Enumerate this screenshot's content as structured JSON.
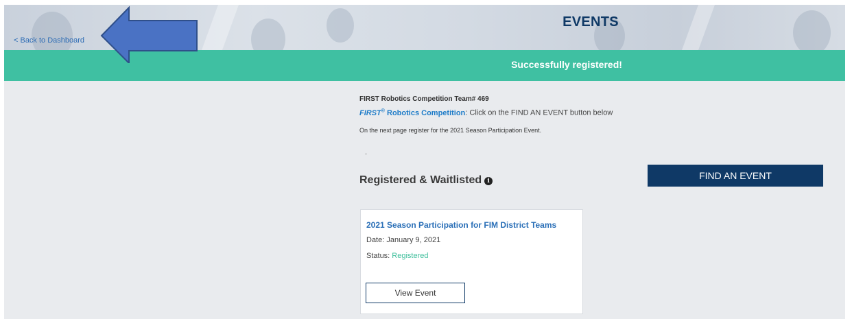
{
  "header": {
    "back_link": "< Back to Dashboard",
    "title": "EVENTS",
    "arrow_icon": "left-arrow-icon"
  },
  "alert": {
    "message": "Successfully registered!"
  },
  "team": {
    "label": "FIRST Robotics Competition Team# 469",
    "program_brand": "FIRST",
    "program_reg": "®",
    "program_rest": " Robotics Competition",
    "instruction": ": Click on the FIND AN EVENT button below",
    "next_step": "On the next page register for the 2021 Season Participation Event.",
    "dash": "-"
  },
  "registered": {
    "heading": "Registered & Waitlisted",
    "info_icon": "info-icon",
    "find_button": "FIND AN EVENT",
    "events": [
      {
        "title": "2021 Season Participation for FIM District Teams",
        "date_label": "Date: ",
        "date": "January 9, 2021",
        "status_label": "Status: ",
        "status": "Registered",
        "button": "View Event"
      }
    ]
  },
  "colors": {
    "navy": "#0f3966",
    "success": "#3fc0a2",
    "link": "#2a6fb7",
    "arrow": "#4a72c4"
  }
}
